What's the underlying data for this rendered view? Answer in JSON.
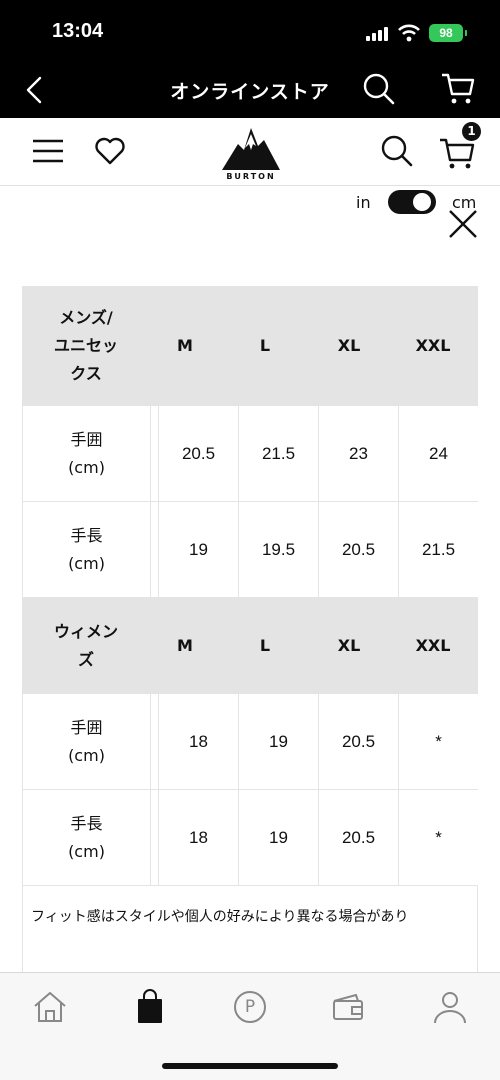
{
  "status_bar": {
    "time": "13:04",
    "battery": "98"
  },
  "app_header": {
    "title": "オンラインストア",
    "icons": [
      "back-icon",
      "search-icon",
      "cart-icon"
    ]
  },
  "site_nav": {
    "logo_text": "BURTON",
    "cart_count": "1",
    "icons": [
      "menu-icon",
      "heart-icon",
      "search-icon",
      "cart-icon"
    ]
  },
  "unit_toggle": {
    "in_label": "in",
    "cm_label": "cm",
    "selected": "cm"
  },
  "size_table": {
    "sections": [
      {
        "header_lines": [
          "メンズ/",
          "ユニセッ",
          "クス"
        ],
        "sizes": [
          "M",
          "L",
          "XL",
          "XXL"
        ],
        "rows": [
          {
            "label_lines": [
              "手囲",
              "(cm)"
            ],
            "values": [
              "20.5",
              "21.5",
              "23",
              "24"
            ]
          },
          {
            "label_lines": [
              "手長",
              "(cm)"
            ],
            "values": [
              "19",
              "19.5",
              "20.5",
              "21.5"
            ]
          }
        ]
      },
      {
        "header_lines": [
          "ウィメン",
          "ズ"
        ],
        "sizes": [
          "M",
          "L",
          "XL",
          "XXL"
        ],
        "rows": [
          {
            "label_lines": [
              "手囲",
              "(cm)"
            ],
            "values": [
              "18",
              "19",
              "20.5",
              "*"
            ]
          },
          {
            "label_lines": [
              "手長",
              "(cm)"
            ],
            "values": [
              "18",
              "19",
              "20.5",
              "*"
            ]
          }
        ]
      }
    ],
    "note": "フィット感はスタイルや個人の好みにより異なる場合があり"
  },
  "tab_bar": {
    "tabs": [
      "home-icon",
      "shopping-bag-icon",
      "points-icon",
      "wallet-icon",
      "profile-icon"
    ],
    "points_glyph": "P"
  }
}
